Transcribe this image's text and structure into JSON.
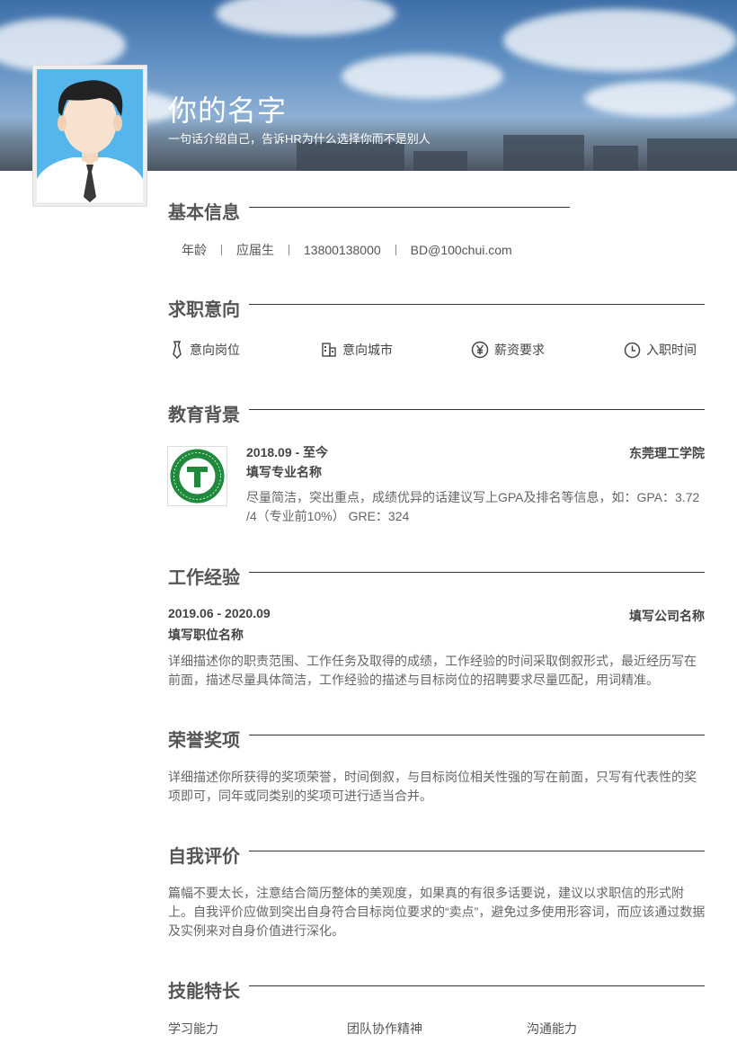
{
  "header": {
    "name": "你的名字",
    "tagline": "一句话介绍自己，告诉HR为什么选择你而不是别人"
  },
  "basic_info": {
    "title": "基本信息",
    "items": [
      "年龄",
      "应届生",
      "13800138000",
      "BD@100chui.com"
    ]
  },
  "job_intent": {
    "title": "求职意向",
    "items": [
      {
        "label": "意向岗位",
        "icon": "tie-icon"
      },
      {
        "label": "意向城市",
        "icon": "building-icon"
      },
      {
        "label": "薪资要求",
        "icon": "yen-icon"
      },
      {
        "label": "入职时间",
        "icon": "clock-icon"
      }
    ]
  },
  "education": {
    "title": "教育背景",
    "period": "2018.09 - 至今",
    "school": "东莞理工学院",
    "major": "填写专业名称",
    "description": "尽量简洁，突出重点，成绩优异的话建议写上GPA及排名等信息，如：GPA：3.72 /4（专业前10%） GRE：324"
  },
  "work": {
    "title": "工作经验",
    "period": "2019.06 - 2020.09",
    "company": "填写公司名称",
    "position": "填写职位名称",
    "description": "详细描述你的职责范围、工作任务及取得的成绩，工作经验的时间采取倒叙形式，最近经历写在前面，描述尽量具体简洁，工作经验的描述与目标岗位的招聘要求尽量匹配，用词精准。"
  },
  "honors": {
    "title": "荣誉奖项",
    "description": "详细描述你所获得的奖项荣誉，时间倒叙，与目标岗位相关性强的写在前面，只写有代表性的奖项即可，同年或同类别的奖项可进行适当合并。"
  },
  "self_eval": {
    "title": "自我评价",
    "description": "篇幅不要太长，注意结合简历整体的美观度，如果真的有很多话要说，建议以求职信的形式附上。自我评价应做到突出自身符合目标岗位要求的“卖点”，避免过多使用形容词，而应该通过数据及实例来对自身价值进行深化。"
  },
  "skills": {
    "title": "技能特长",
    "items": [
      "学习能力",
      "团队协作精神",
      "沟通能力"
    ]
  },
  "colors": {
    "avatar_bg": "#54b6ea",
    "logo_green": "#1f8a3c",
    "text": "#555555"
  }
}
